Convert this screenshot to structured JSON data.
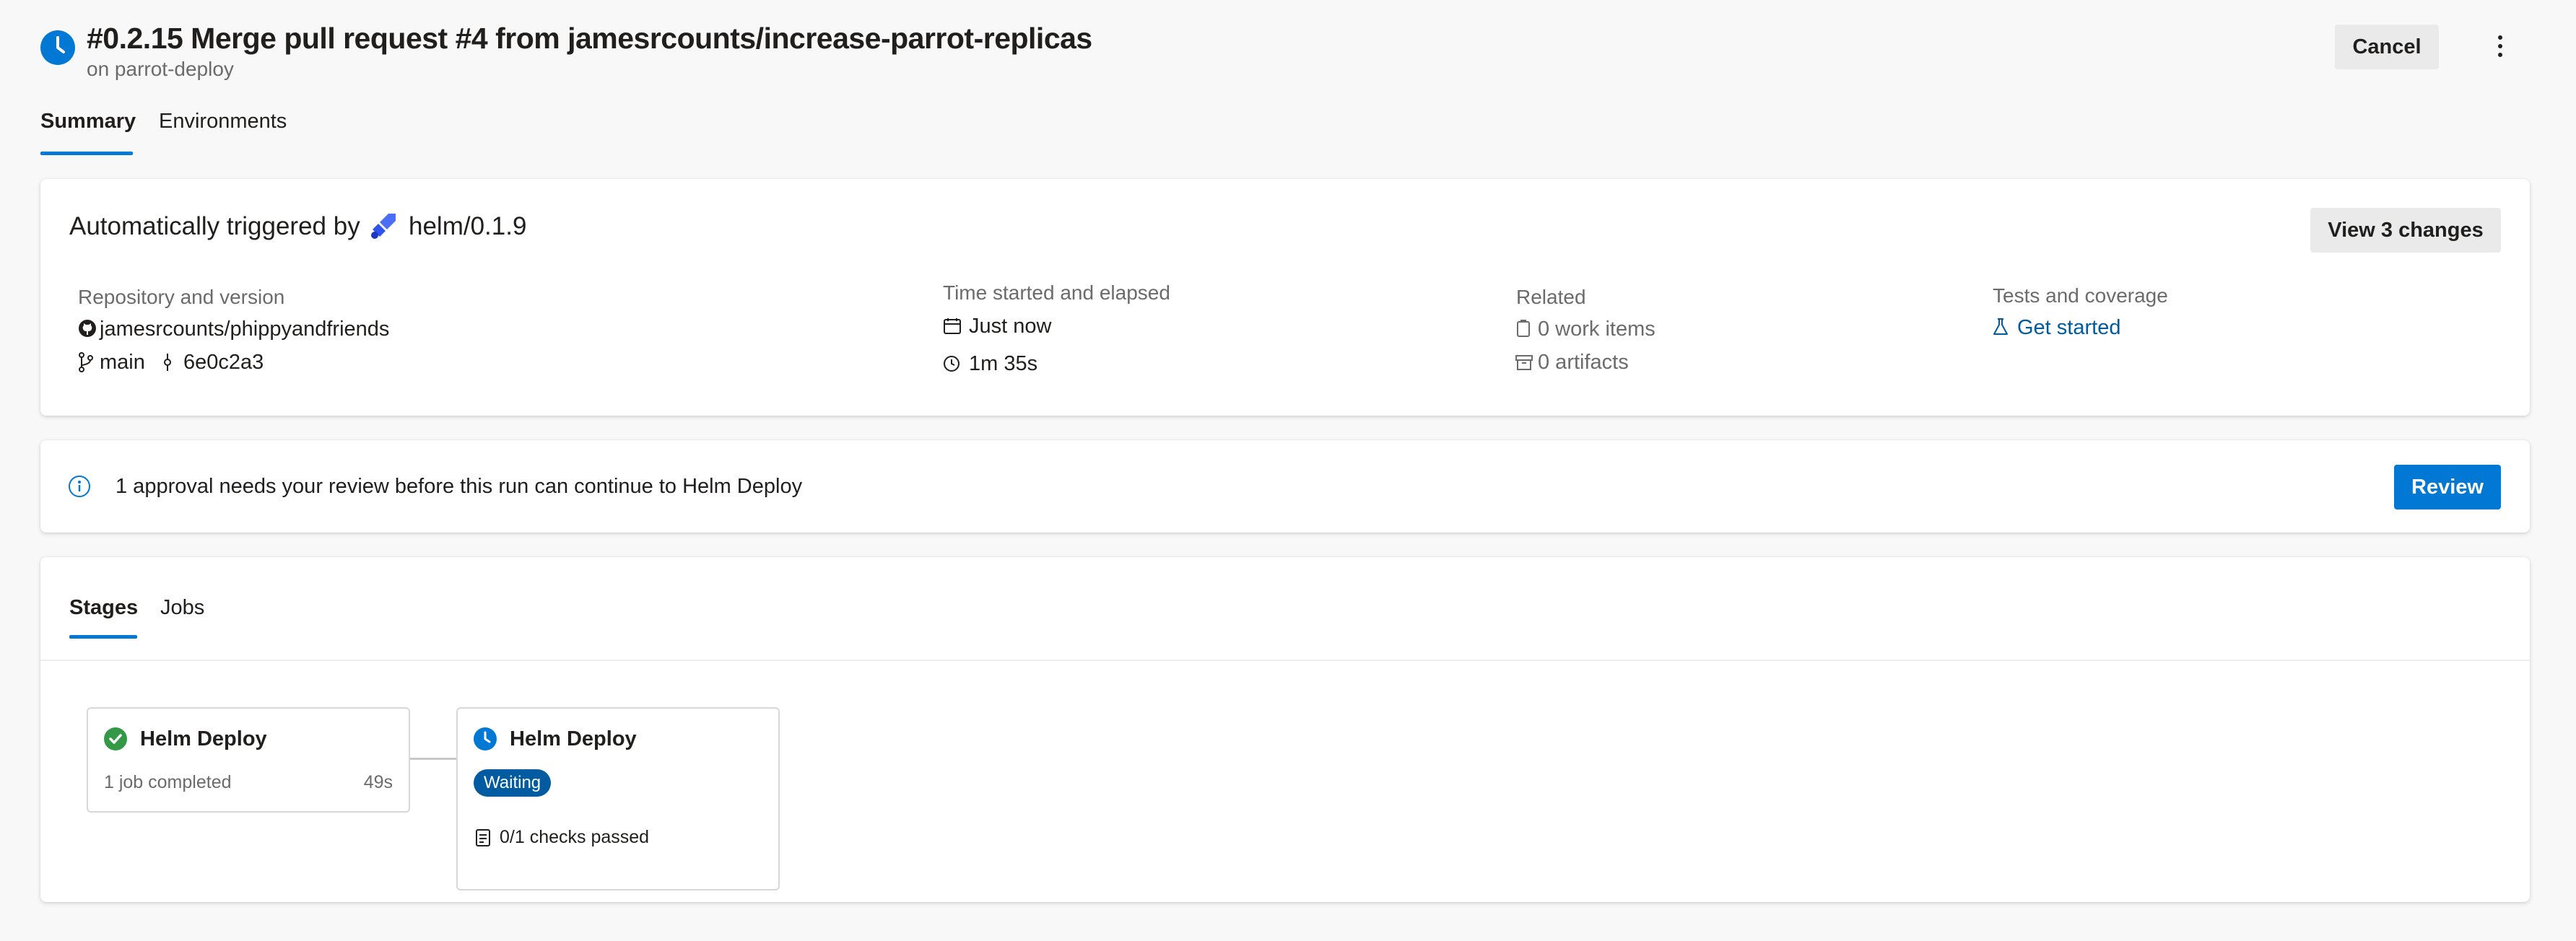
{
  "header": {
    "title": "#0.2.15 Merge pull request #4 from jamesrcounts/increase-parrot-replicas",
    "subtitle": "on parrot-deploy",
    "cancel_label": "Cancel"
  },
  "tabs": {
    "summary": "Summary",
    "environments": "Environments"
  },
  "summary_card": {
    "trigger_prefix": "Automatically triggered by",
    "trigger_source": "helm/0.1.9",
    "view_changes_label": "View 3 changes",
    "repo": {
      "heading": "Repository and version",
      "name": "jamesrcounts/phippyandfriends",
      "branch": "main",
      "commit": "6e0c2a3"
    },
    "time": {
      "heading": "Time started and elapsed",
      "started": "Just now",
      "elapsed": "1m 35s"
    },
    "related": {
      "heading": "Related",
      "work_items": "0 work items",
      "artifacts": "0 artifacts"
    },
    "tests": {
      "heading": "Tests and coverage",
      "link": "Get started"
    }
  },
  "approval": {
    "message": "1 approval needs your review before this run can continue to Helm Deploy",
    "review_label": "Review"
  },
  "stages_card": {
    "tabs": {
      "stages": "Stages",
      "jobs": "Jobs"
    },
    "stages": [
      {
        "name": "Helm Deploy",
        "status": "succeeded",
        "detail": "1 job completed",
        "duration": "49s"
      },
      {
        "name": "Helm Deploy",
        "status": "waiting",
        "badge": "Waiting",
        "checks": "0/1 checks passed"
      }
    ]
  },
  "colors": {
    "accent": "#0078d4",
    "success": "#339947",
    "waiting_badge": "#005ba1",
    "link": "#005a9e",
    "background": "#f8f8f8"
  }
}
